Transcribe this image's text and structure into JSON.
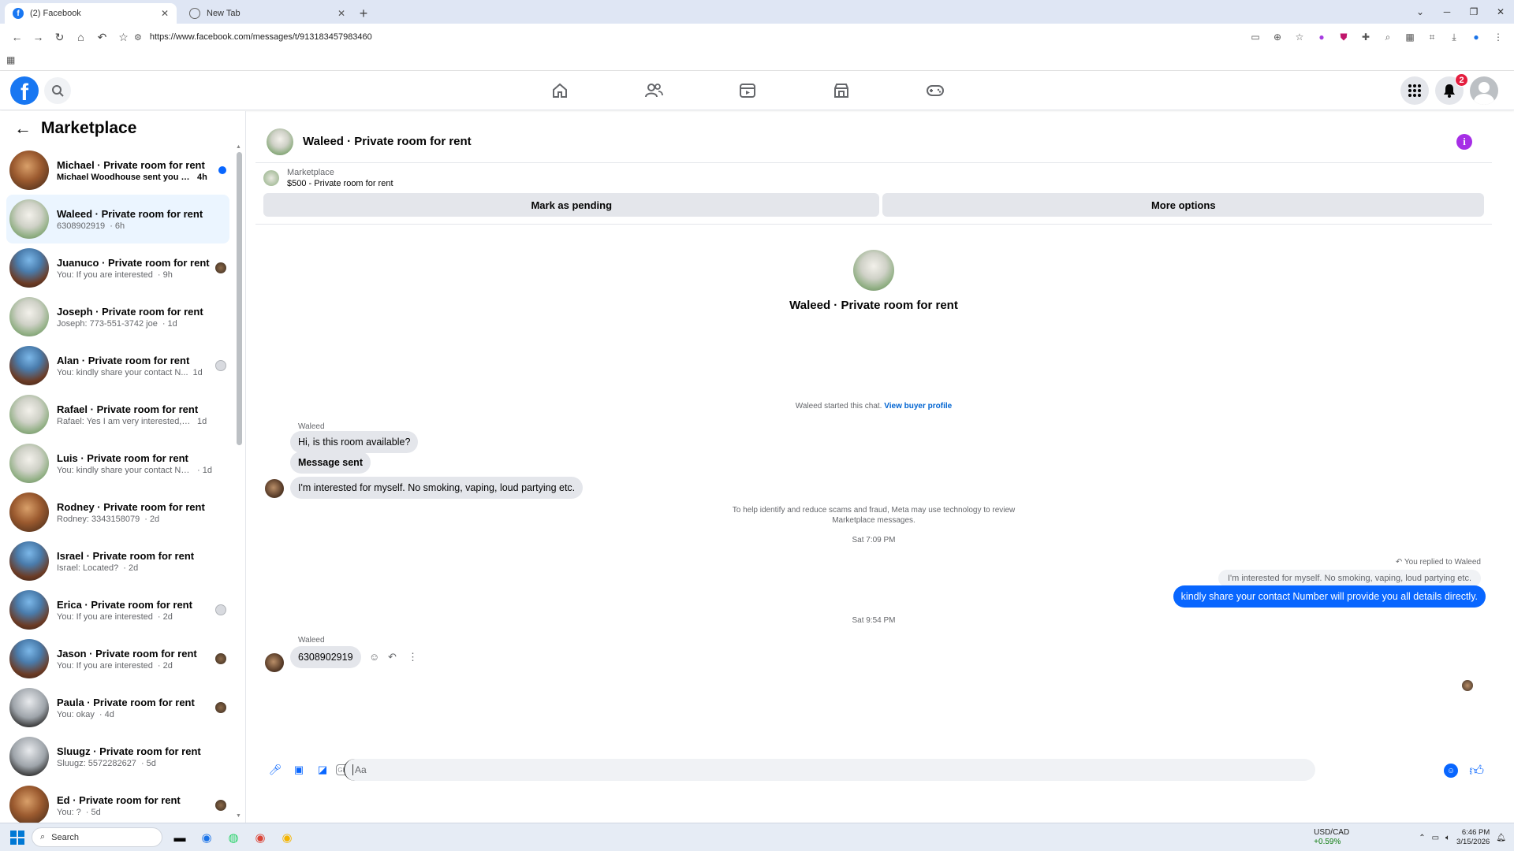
{
  "browser": {
    "tabs": [
      {
        "label": "(2) Facebook",
        "active": true
      },
      {
        "label": "New Tab",
        "active": false
      }
    ],
    "url": "https://www.facebook.com/messages/t/913183457983460"
  },
  "fb": {
    "notifications_count": "2"
  },
  "sidebar": {
    "title": "Marketplace",
    "conversations": [
      {
        "title": "Michael · Private room for rent",
        "preview": "Michael Woodhouse sent you a ...",
        "time": "4h",
        "avatar": "warm",
        "status": "unread",
        "bold": true,
        "selected": false
      },
      {
        "title": "Waleed · Private room for rent",
        "preview": "6308902919",
        "time": "· 6h",
        "avatar": "green",
        "status": "none",
        "bold": false,
        "selected": true
      },
      {
        "title": "Juanuco · Private room for rent",
        "preview": "You: If you are interested",
        "time": "· 9h",
        "avatar": "blue",
        "status": "seen",
        "bold": false,
        "selected": false
      },
      {
        "title": "Joseph · Private room for rent",
        "preview": "Joseph: 773-551-3742 joe",
        "time": "· 1d",
        "avatar": "green",
        "status": "none",
        "bold": false,
        "selected": false
      },
      {
        "title": "Alan · Private room for rent",
        "preview": "You: kindly share your contact N...",
        "time": "1d",
        "avatar": "blue",
        "status": "ghost",
        "bold": false,
        "selected": false
      },
      {
        "title": "Rafael · Private room for rent",
        "preview": "Rafael: Yes I am very interested, but...",
        "time": "1d",
        "avatar": "green",
        "status": "none",
        "bold": false,
        "selected": false
      },
      {
        "title": "Luis · Private room for rent",
        "preview": "You: kindly share your contact Num...",
        "time": "· 1d",
        "avatar": "green",
        "status": "none",
        "bold": false,
        "selected": false
      },
      {
        "title": "Rodney · Private room for rent",
        "preview": "Rodney: 3343158079",
        "time": "· 2d",
        "avatar": "warm",
        "status": "none",
        "bold": false,
        "selected": false
      },
      {
        "title": "Israel · Private room for rent",
        "preview": "Israel: Located?",
        "time": "· 2d",
        "avatar": "blue",
        "status": "none",
        "bold": false,
        "selected": false
      },
      {
        "title": "Erica · Private room for rent",
        "preview": "You: If you are interested",
        "time": "· 2d",
        "avatar": "blue",
        "status": "ghost",
        "bold": false,
        "selected": false
      },
      {
        "title": "Jason · Private room for rent",
        "preview": "You: If you are interested",
        "time": "· 2d",
        "avatar": "blue",
        "status": "seen",
        "bold": false,
        "selected": false
      },
      {
        "title": "Paula · Private room for rent",
        "preview": "You: okay",
        "time": "· 4d",
        "avatar": "gray",
        "status": "seen",
        "bold": false,
        "selected": false
      },
      {
        "title": "Sluugz · Private room for rent",
        "preview": "Sluugz: 5572282627",
        "time": "· 5d",
        "avatar": "gray",
        "status": "none",
        "bold": false,
        "selected": false
      },
      {
        "title": "Ed · Private room for rent",
        "preview": "You: ?",
        "time": "· 5d",
        "avatar": "warm",
        "status": "seen",
        "bold": false,
        "selected": false
      }
    ]
  },
  "chat": {
    "title": "Waleed · Private room for rent",
    "listing": {
      "source": "Marketplace",
      "summary": "$500 - Private room for rent",
      "mark_pending": "Mark as pending",
      "more_options": "More options"
    },
    "intro_name": "Waleed · Private room for rent",
    "started_text": "Waleed started this chat.",
    "view_profile": "View buyer profile",
    "sender_name": "Waleed",
    "msg1": "Hi, is this room available?",
    "msg2": "Message sent",
    "msg3": "I'm interested for myself. No smoking, vaping, loud partying etc.",
    "notice_line1": "To help identify and reduce scams and fraud, Meta may use technology to review",
    "notice_line2": "Marketplace messages.",
    "ts1": "Sat 7:09 PM",
    "replied_label": "You replied to Waleed",
    "quoted_text": "I'm interested for myself. No smoking, vaping, loud partying etc.",
    "out_msg": "kindly share your contact Number will provide you all details directly.",
    "ts2": "Sat 9:54 PM",
    "sender_name2": "Waleed",
    "msg4": "6308902919",
    "composer_placeholder": "Aa"
  },
  "taskbar": {
    "search_placeholder": "Search",
    "currency_pair": "USD/CAD",
    "currency_change": "+0.59%",
    "time": "6:46 PM",
    "date": "3/15/2026"
  }
}
